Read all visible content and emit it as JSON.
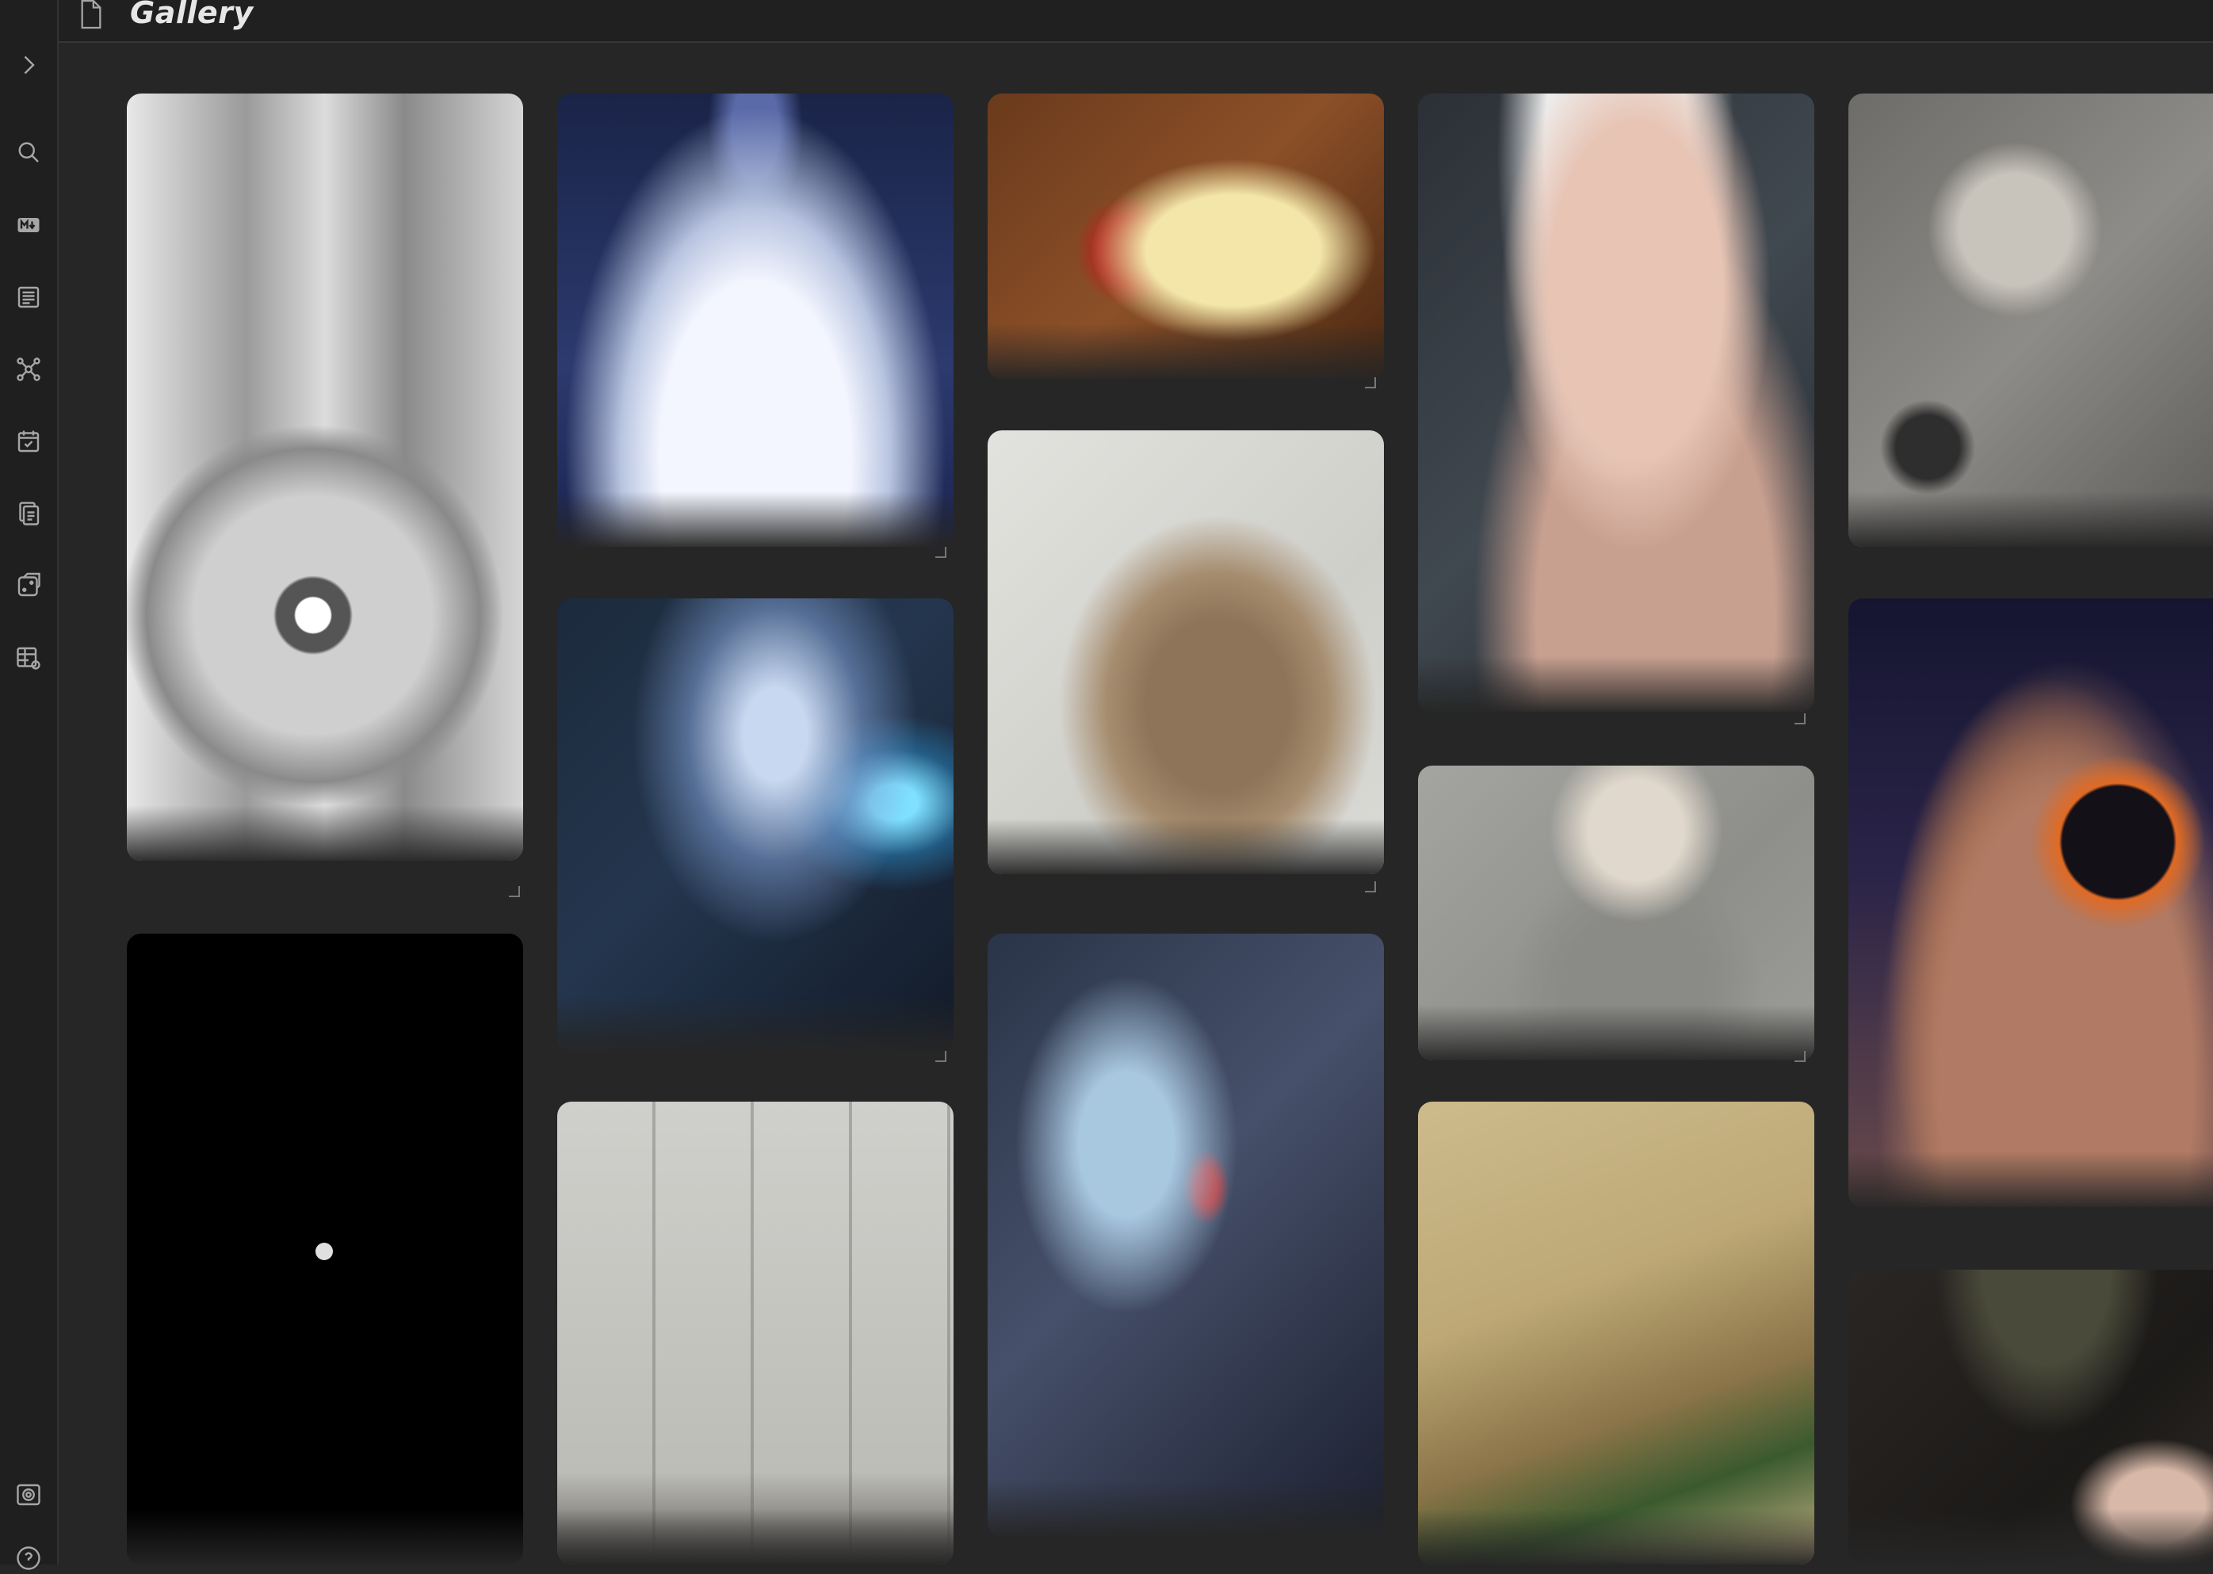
{
  "window": {
    "title": "Gallery"
  },
  "ribbon": {
    "items": [
      {
        "name": "expand-sidebar-icon"
      },
      {
        "name": "search-icon"
      },
      {
        "name": "markdown-icon"
      },
      {
        "name": "document-icon"
      },
      {
        "name": "graph-view-icon"
      },
      {
        "name": "calendar-check-icon"
      },
      {
        "name": "pages-icon"
      },
      {
        "name": "dice-icon"
      },
      {
        "name": "table-settings-icon"
      },
      {
        "name": "vault-icon"
      },
      {
        "name": "help-icon"
      }
    ]
  },
  "gallery": {
    "images": [
      {
        "subject": "robot-eye-sketch"
      },
      {
        "subject": "glowing-potion-flask"
      },
      {
        "subject": "letters-with-wax-seal"
      },
      {
        "subject": "white-haired-woman-portrait"
      },
      {
        "subject": "skull-creature"
      },
      {
        "subject": "hooded-mage-with-spellbook"
      },
      {
        "subject": "insect-creature-sketch"
      },
      {
        "subject": "tattooed-woman"
      },
      {
        "subject": "eclipse-planets"
      },
      {
        "subject": "black-with-dot"
      },
      {
        "subject": "daggers-sketch"
      },
      {
        "subject": "knight-and-princess"
      },
      {
        "subject": "open-old-book"
      },
      {
        "subject": "girl-with-hat"
      }
    ]
  }
}
